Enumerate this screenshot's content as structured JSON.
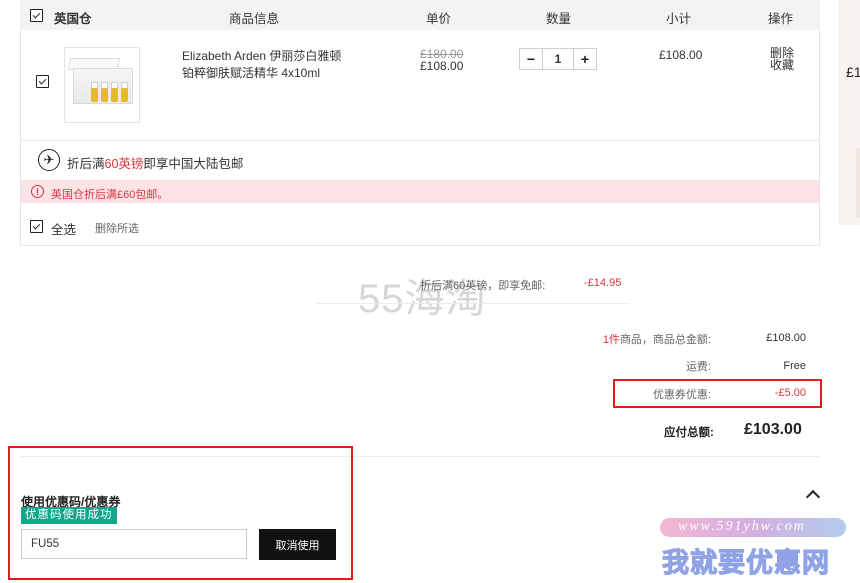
{
  "header": {
    "warehouse": "英国仓",
    "product_info": "商品信息",
    "unit_price": "单价",
    "quantity": "数量",
    "subtotal": "小计",
    "actions": "操作"
  },
  "item": {
    "name": "Elizabeth Arden 伊丽莎白雅顿 铂粹御肤赋活精华 4x10ml",
    "original_price": "£180.00",
    "price": "£108.00",
    "quantity": "1",
    "minus": "−",
    "plus": "+",
    "subtotal": "£108.00",
    "delete": "删除",
    "favorite": "收藏"
  },
  "promo": {
    "prefix": "折后满",
    "highlight": "60英镑",
    "suffix": "即享中国大陆包邮",
    "alert_icon": "!",
    "alert": "英国仓折后满£60包邮。"
  },
  "footer_bar": {
    "select_all": "全选",
    "delete_selected": "删除所选"
  },
  "summary": {
    "watermark": "55海淘",
    "free_ship_label": "折后满60英镑，即享免邮:",
    "free_ship_value": "-£14.95",
    "count": "1件",
    "goods_total_label": "商品，商品总金额:",
    "goods_total": "£108.00",
    "shipping_label": "运费:",
    "shipping": "Free",
    "coupon_label": "优惠券优惠:",
    "coupon": "-£5.00",
    "total_label": "应付总额:",
    "total": "£103.00"
  },
  "coupon_panel": {
    "title": "使用优惠码/优惠券",
    "success": "优惠码使用成功",
    "code": "FU55",
    "cancel": "取消使用"
  },
  "side": {
    "price_fragment": "£1"
  },
  "site_watermark": {
    "url": "www.591yhw.com",
    "text": "我就要优惠网"
  },
  "colors": {
    "accent_red": "#d9363e",
    "success_green": "#17a589",
    "highlight_frame": "#e01b1b"
  }
}
